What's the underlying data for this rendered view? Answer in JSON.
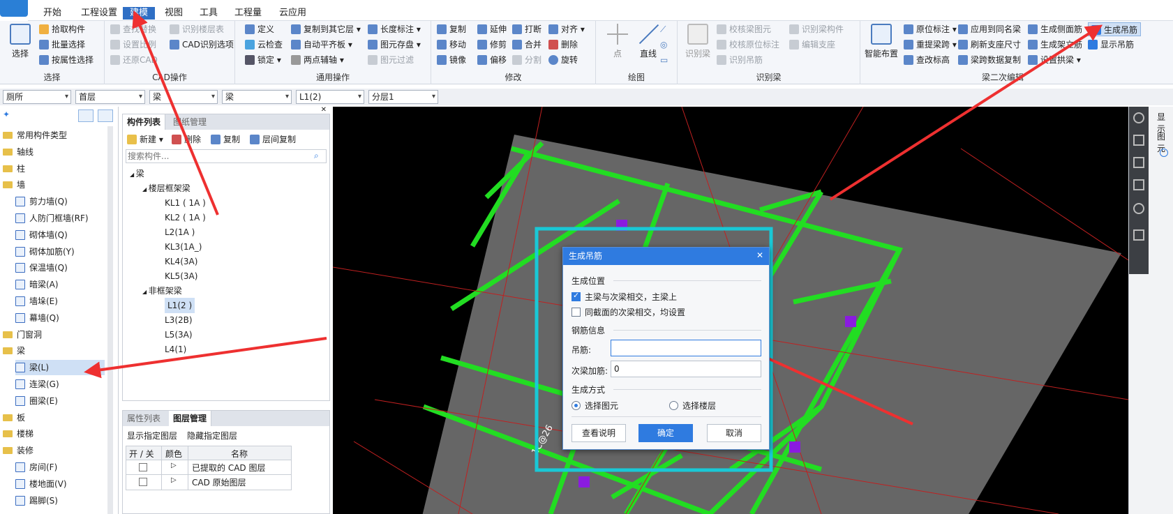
{
  "menu": {
    "items": [
      "开始",
      "工程设置",
      "建模",
      "视图",
      "工具",
      "工程量",
      "云应用"
    ],
    "active": "建模"
  },
  "ribbon": {
    "select_group": {
      "big_label": "选择",
      "items": [
        "拾取构件",
        "批量选择",
        "按属性选择"
      ],
      "group_label": "选择"
    },
    "cad_group": {
      "items": [
        "查找替换",
        "识别楼层表",
        "设置比例",
        "CAD识别选项",
        "还原CAD"
      ],
      "group_label": "CAD操作"
    },
    "general_group": {
      "items": [
        "定义",
        "复制到其它层",
        "长度标注",
        "云检查",
        "自动平齐板",
        "图元存盘",
        "锁定",
        "两点辅轴",
        "图元过滤"
      ],
      "group_label": "通用操作"
    },
    "modify_group": {
      "items": [
        "复制",
        "延伸",
        "打断",
        "对齐",
        "移动",
        "修剪",
        "合并",
        "删除",
        "镜像",
        "偏移",
        "分割",
        "旋转"
      ],
      "group_label": "修改"
    },
    "draw_group": {
      "items": [
        "点",
        "直线"
      ],
      "group_label": "绘图"
    },
    "identify_group": {
      "items": [
        "识别梁",
        "校核梁图元",
        "识别梁构件",
        "校核原位标注",
        "编辑支座",
        "识别吊筋"
      ],
      "group_label": "识别梁"
    },
    "beam_edit_group": {
      "items": [
        "智能布置",
        "原位标注",
        "应用到同名梁",
        "生成侧面筋",
        "生成吊筋",
        "重提梁跨",
        "刷新支座尺寸",
        "生成架立筋",
        "显示吊筋",
        "查改标高",
        "梁跨数据复制",
        "设置拱梁"
      ],
      "group_label": "梁二次编辑"
    }
  },
  "selectors": [
    "厕所",
    "首层",
    "梁",
    "梁",
    "L1(2)",
    "分层1"
  ],
  "left_tree": {
    "items": [
      {
        "label": "常用构件类型",
        "type": "folder"
      },
      {
        "label": "轴线",
        "type": "folder"
      },
      {
        "label": "柱",
        "type": "folder"
      },
      {
        "label": "墙",
        "type": "folder"
      },
      {
        "label": "剪力墙(Q)",
        "type": "child"
      },
      {
        "label": "人防门框墙(RF)",
        "type": "child"
      },
      {
        "label": "砌体墙(Q)",
        "type": "child"
      },
      {
        "label": "砌体加筋(Y)",
        "type": "child"
      },
      {
        "label": "保温墙(Q)",
        "type": "child"
      },
      {
        "label": "暗梁(A)",
        "type": "child"
      },
      {
        "label": "墙垛(E)",
        "type": "child"
      },
      {
        "label": "幕墙(Q)",
        "type": "child"
      },
      {
        "label": "门窗洞",
        "type": "folder"
      },
      {
        "label": "梁",
        "type": "folder"
      },
      {
        "label": "梁(L)",
        "type": "child",
        "selected": true
      },
      {
        "label": "连梁(G)",
        "type": "child"
      },
      {
        "label": "圈梁(E)",
        "type": "child"
      },
      {
        "label": "板",
        "type": "folder"
      },
      {
        "label": "楼梯",
        "type": "folder"
      },
      {
        "label": "装修",
        "type": "folder"
      },
      {
        "label": "房间(F)",
        "type": "child"
      },
      {
        "label": "楼地面(V)",
        "type": "child"
      },
      {
        "label": "踢脚(S)",
        "type": "child"
      }
    ]
  },
  "component_list": {
    "tabs": [
      "构件列表",
      "图纸管理"
    ],
    "toolbar": [
      "新建",
      "删除",
      "复制",
      "层间复制"
    ],
    "search_placeholder": "搜索构件...",
    "root": "梁",
    "groups": [
      {
        "name": "楼层框架梁",
        "items": [
          "KL1 ( 1A )",
          "KL2 ( 1A )",
          "L2(1A )",
          "KL3(1A_)",
          "KL4(3A)",
          "KL5(3A)"
        ]
      },
      {
        "name": "非框架梁",
        "items": [
          "L1(2 )",
          "L3(2B)",
          "L5(3A)",
          "L4(1)"
        ]
      }
    ],
    "selected": "L1(2 )"
  },
  "layer_panel": {
    "tabs": [
      "属性列表",
      "图层管理"
    ],
    "actions": [
      "显示指定图层",
      "隐藏指定图层"
    ],
    "columns": [
      "开 / 关",
      "颜色",
      "名称"
    ],
    "rows": [
      "已提取的 CAD 图层",
      "CAD 原始图层"
    ]
  },
  "right_strip": {
    "label1": "显示",
    "label2": "图元"
  },
  "canvas": {
    "annotation": "1C@26"
  },
  "dialog": {
    "title": "生成吊筋",
    "section_position": "生成位置",
    "opt1": "主梁与次梁相交，主梁上",
    "opt1_checked": true,
    "opt2": "同截面的次梁相交，均设置",
    "opt2_checked": false,
    "section_rebar": "钢筋信息",
    "field1_label": "吊筋:",
    "field1_value": "",
    "field2_label": "次梁加筋:",
    "field2_value": "0",
    "section_mode": "生成方式",
    "radio1": "选择图元",
    "radio2": "选择楼层",
    "radio_selected": "选择图元",
    "btn_help": "查看说明",
    "btn_ok": "确定",
    "btn_cancel": "取消"
  },
  "colors": {
    "accent": "#2f7be0",
    "beam_green": "#22dd22",
    "highlight_cyan": "#19c8d6",
    "arrow_red": "#ee3030",
    "purple": "#8a1be0"
  }
}
